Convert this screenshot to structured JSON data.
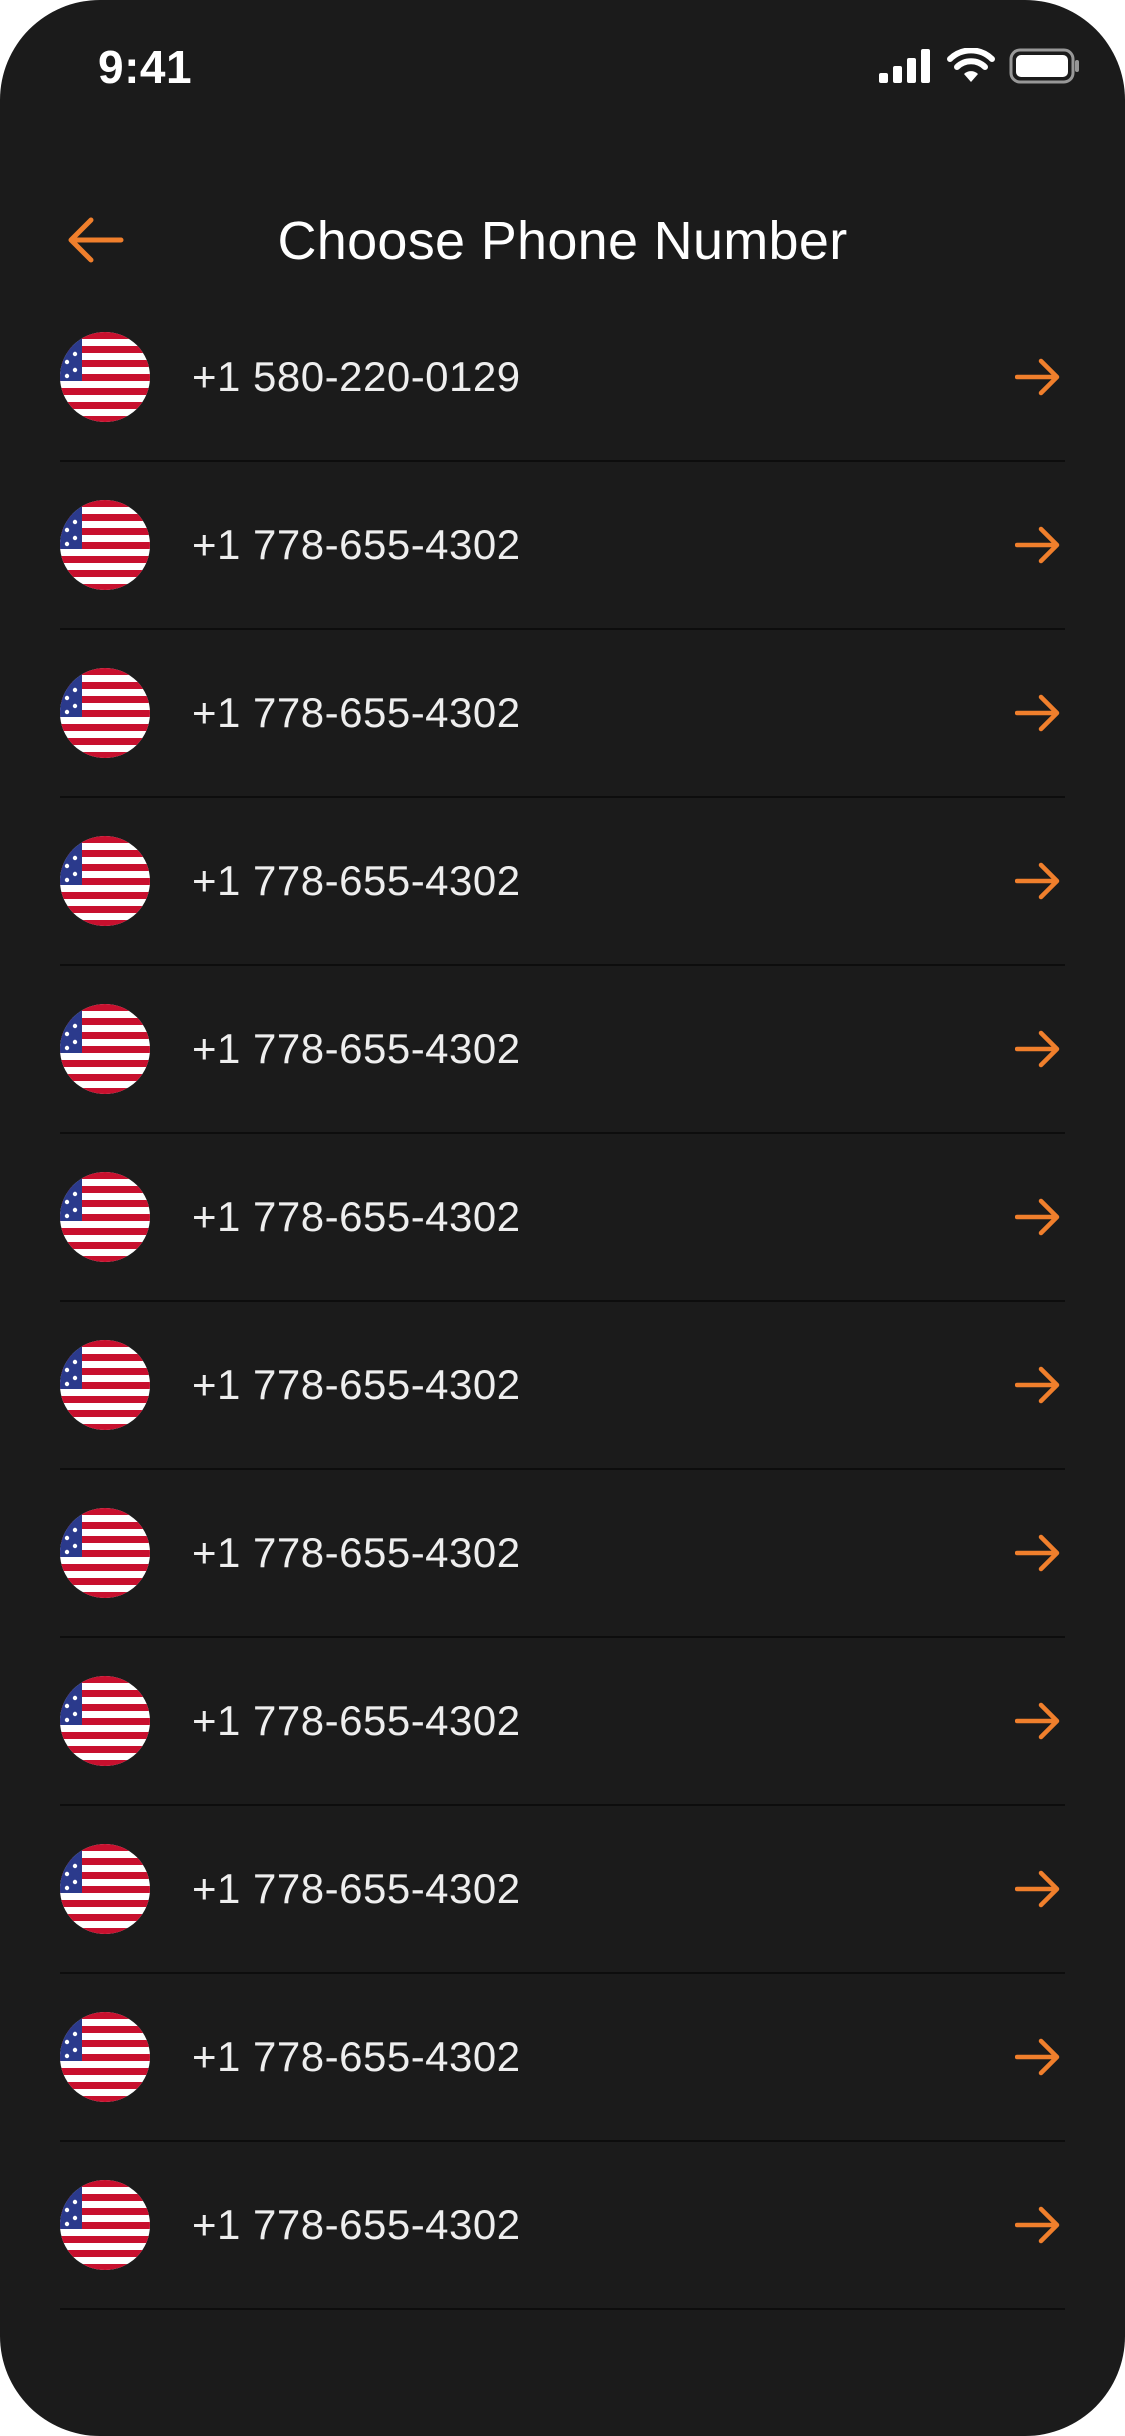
{
  "status_bar": {
    "time": "9:41",
    "icons": [
      "cellular-signal-icon",
      "wifi-icon",
      "battery-icon"
    ]
  },
  "header": {
    "title": "Choose Phone Number",
    "back_icon": "arrow-left-icon"
  },
  "colors": {
    "background": "#1b1b1b",
    "accent": "#f07f2c",
    "text": "#ffffff",
    "divider": "#0d0d0d"
  },
  "phone_numbers": [
    {
      "number": "+1 580-220-0129",
      "flag": "us-flag-icon",
      "arrow": "arrow-right-icon"
    },
    {
      "number": "+1 778-655-4302",
      "flag": "us-flag-icon",
      "arrow": "arrow-right-icon"
    },
    {
      "number": "+1 778-655-4302",
      "flag": "us-flag-icon",
      "arrow": "arrow-right-icon"
    },
    {
      "number": "+1 778-655-4302",
      "flag": "us-flag-icon",
      "arrow": "arrow-right-icon"
    },
    {
      "number": "+1 778-655-4302",
      "flag": "us-flag-icon",
      "arrow": "arrow-right-icon"
    },
    {
      "number": "+1 778-655-4302",
      "flag": "us-flag-icon",
      "arrow": "arrow-right-icon"
    },
    {
      "number": "+1 778-655-4302",
      "flag": "us-flag-icon",
      "arrow": "arrow-right-icon"
    },
    {
      "number": "+1 778-655-4302",
      "flag": "us-flag-icon",
      "arrow": "arrow-right-icon"
    },
    {
      "number": "+1 778-655-4302",
      "flag": "us-flag-icon",
      "arrow": "arrow-right-icon"
    },
    {
      "number": "+1 778-655-4302",
      "flag": "us-flag-icon",
      "arrow": "arrow-right-icon"
    },
    {
      "number": "+1 778-655-4302",
      "flag": "us-flag-icon",
      "arrow": "arrow-right-icon"
    },
    {
      "number": "+1 778-655-4302",
      "flag": "us-flag-icon",
      "arrow": "arrow-right-icon"
    }
  ]
}
